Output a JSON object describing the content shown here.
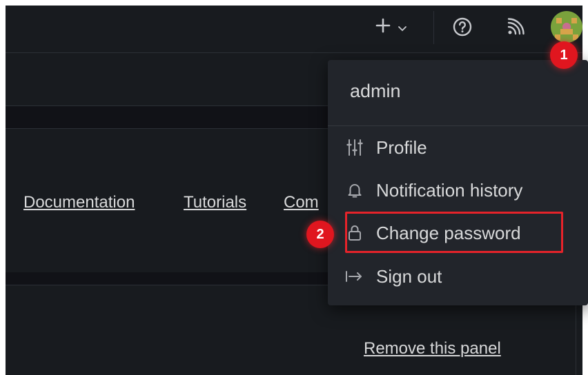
{
  "topbar": {
    "icons": [
      "plus-icon",
      "chevron-down-icon",
      "help-icon",
      "rss-icon",
      "avatar"
    ]
  },
  "content": {
    "links": {
      "documentation": "Documentation",
      "tutorials": "Tutorials",
      "community": "Com"
    },
    "remove_panel": "Remove this panel"
  },
  "user_menu": {
    "username": "admin",
    "items": [
      {
        "label": "Profile",
        "icon": "sliders-icon"
      },
      {
        "label": "Notification history",
        "icon": "bell-icon"
      },
      {
        "label": "Change password",
        "icon": "lock-icon"
      },
      {
        "label": "Sign out",
        "icon": "sign-out-icon"
      }
    ]
  },
  "annotations": {
    "step1": "1",
    "step2": "2",
    "highlight_color": "#e6232a"
  }
}
